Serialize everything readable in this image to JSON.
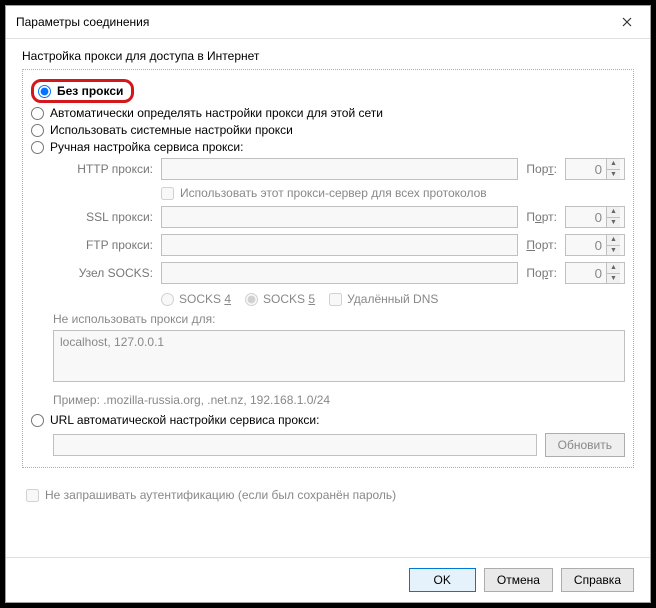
{
  "window": {
    "title": "Параметры соединения"
  },
  "section_title": "Настройка прокси для доступа в Интернет",
  "radios": {
    "no_proxy": "Без прокси",
    "auto_detect": "Автоматически определять настройки прокси для этой сети",
    "system": "Использовать системные настройки прокси",
    "manual": "Ручная настройка сервиса прокси:",
    "auto_url": "URL автоматической настройки сервиса прокси:"
  },
  "labels": {
    "http": "HTTP прокси:",
    "ssl": "SSL прокси:",
    "ftp": "FTP прокси:",
    "socks": "Узел SOCKS:",
    "port": "Порт:",
    "use_for_all": "Использовать этот прокси-сервер для всех протоколов",
    "socks4": "SOCKS 4",
    "socks5": "SOCKS 5",
    "remote_dns": "Удалённый DNS",
    "noproxy_for": "Не использовать прокси для:",
    "example": "Пример: .mozilla-russia.org, .net.nz, 192.168.1.0/24",
    "reload": "Обновить",
    "no_auth": "Не запрашивать аутентификацию (если был сохранён пароль)"
  },
  "values": {
    "http_host": "",
    "http_port": "0",
    "ssl_host": "",
    "ssl_port": "0",
    "ftp_host": "",
    "ftp_port": "0",
    "socks_host": "",
    "socks_port": "0",
    "noproxy": "localhost, 127.0.0.1",
    "auto_url": ""
  },
  "footer": {
    "ok": "OK",
    "cancel": "Отмена",
    "help": "Справка"
  }
}
